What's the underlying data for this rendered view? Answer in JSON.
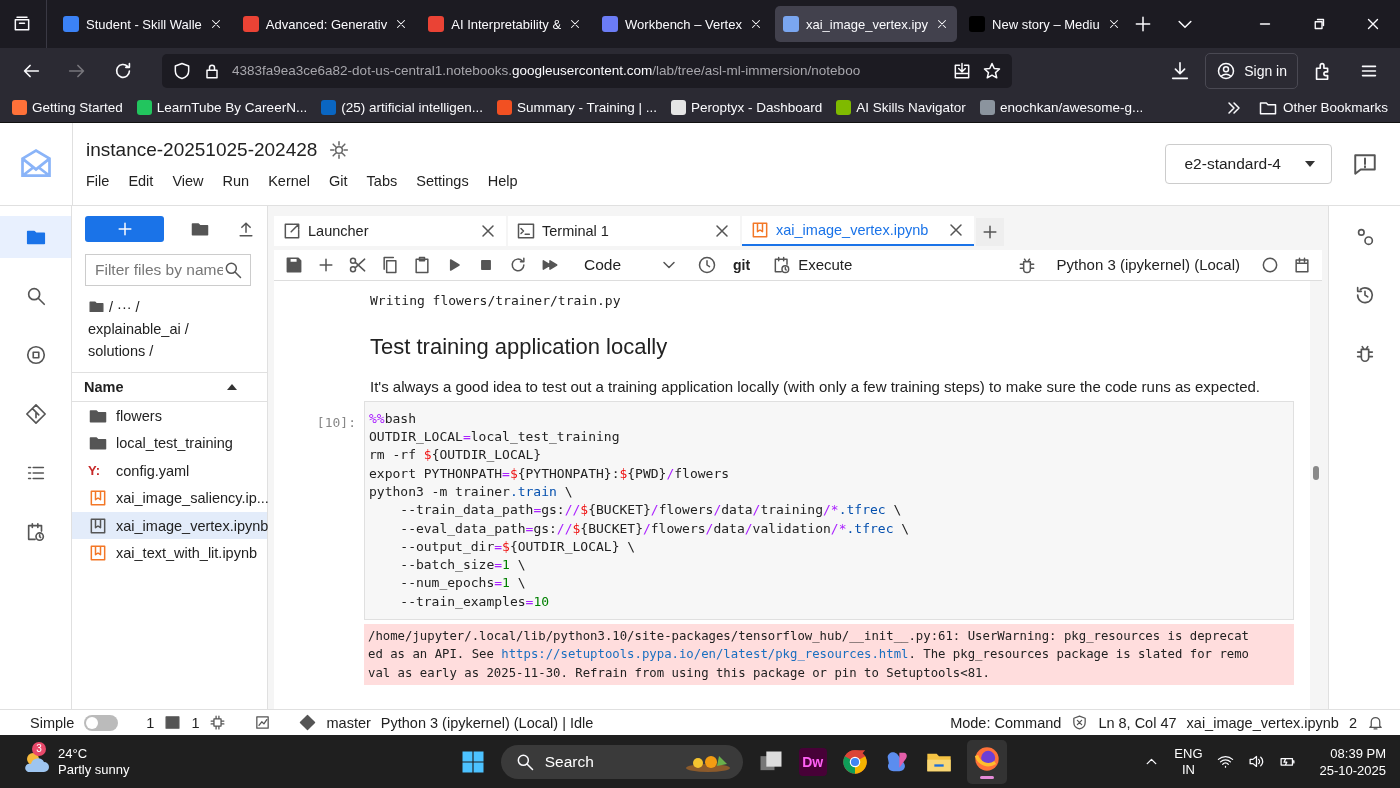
{
  "browser": {
    "tabs": [
      {
        "title": "Student - Skill Walle",
        "color": "#3b82f6",
        "selected": false
      },
      {
        "title": "Advanced: Generativ",
        "color": "#ea4335",
        "selected": false
      },
      {
        "title": "AI Interpretability &",
        "color": "#ea4335",
        "selected": false
      },
      {
        "title": "Workbench – Vertex",
        "color": "#6b7cf5",
        "selected": false
      },
      {
        "title": "xai_image_vertex.ipy",
        "color": "#7aa6f0",
        "selected": true
      },
      {
        "title": "New story – Mediu",
        "color": "#000000",
        "selected": false
      }
    ],
    "url": {
      "prefix": "4383fa9ea3ce6a82-dot-us-central1.notebooks.",
      "domain": "googleusercontent.com",
      "path": "/lab/tree/asl-ml-immersion/noteboo"
    },
    "sign_in": "Sign in",
    "bookmarks": [
      {
        "label": "Getting Started",
        "color": "#ff7139"
      },
      {
        "label": "LearnTube By CareerN...",
        "color": "#22c55e"
      },
      {
        "label": "(25) artificial intelligen...",
        "color": "#0a66c2"
      },
      {
        "label": "Summary - Training | ...",
        "color": "#f25022"
      },
      {
        "label": "Peroptyx - Dashboard",
        "color": "#e5e5e5"
      },
      {
        "label": "AI Skills Navigator",
        "color": "#7fba00"
      },
      {
        "label": "enochkan/awesome-g...",
        "color": "#8b949e"
      }
    ],
    "other_bookmarks": "Other Bookmarks"
  },
  "lab": {
    "title": "instance-20251025-202428",
    "menu": [
      "File",
      "Edit",
      "View",
      "Run",
      "Kernel",
      "Git",
      "Tabs",
      "Settings",
      "Help"
    ],
    "machine": "e2-standard-4",
    "activity_bar": [
      {
        "kind": "files",
        "selected": true
      },
      {
        "kind": "search",
        "selected": false
      },
      {
        "kind": "running",
        "selected": false
      },
      {
        "kind": "git",
        "selected": false
      },
      {
        "kind": "toc",
        "selected": false
      },
      {
        "kind": "schedule",
        "selected": false
      }
    ],
    "right_bar": [
      {
        "kind": "properties"
      },
      {
        "kind": "history"
      },
      {
        "kind": "debugger"
      }
    ]
  },
  "file_browser": {
    "filter_placeholder": "Filter files by name",
    "path": [
      "/ ··· /",
      "explainable_ai /",
      "solutions /"
    ],
    "column": "Name",
    "files": [
      {
        "name": "flowers",
        "kind": "folder",
        "selected": false
      },
      {
        "name": "local_test_training",
        "kind": "folder",
        "selected": false
      },
      {
        "name": "config.yaml",
        "kind": "yaml",
        "icon_text": "Y:",
        "selected": false
      },
      {
        "name": "xai_image_saliency.ip...",
        "kind": "notebook",
        "selected": false
      },
      {
        "name": "xai_image_vertex.ipynb",
        "kind": "notebook",
        "selected": true
      },
      {
        "name": "xai_text_with_lit.ipynb",
        "kind": "notebook",
        "selected": false
      }
    ]
  },
  "notebook": {
    "tabs": [
      {
        "label": "Launcher",
        "kind": "launcher",
        "selected": false
      },
      {
        "label": "Terminal 1",
        "kind": "terminal",
        "selected": false
      },
      {
        "label": "xai_image_vertex.ipynb",
        "kind": "notebook",
        "selected": true
      }
    ],
    "toolbar": {
      "cell_type": "Code",
      "git": "git",
      "execute": "Execute",
      "kernel": "Python 3 (ipykernel) (Local)"
    },
    "previous_output": "Writing flowers/trainer/train.py",
    "heading": "Test training application locally",
    "paragraph": "It's always a good idea to test out a training application locally (with only a few training steps) to make sure the code runs as expected.",
    "cell": {
      "prompt": "[10]:",
      "lines": [
        [
          {
            "text": "%%",
            "kind": "magic"
          },
          {
            "text": "bash",
            "kind": "plain"
          }
        ],
        [
          {
            "text": "OUTDIR_LOCAL",
            "kind": "plain"
          },
          {
            "text": "=",
            "kind": "op"
          },
          {
            "text": "local_test_training",
            "kind": "plain"
          }
        ],
        [
          {
            "text": "rm -rf ",
            "kind": "plain"
          },
          {
            "text": "$",
            "kind": "var"
          },
          {
            "text": "{OUTDIR_LOCAL}",
            "kind": "plain"
          }
        ],
        [
          {
            "text": "export PYTHONPATH",
            "kind": "plain"
          },
          {
            "text": "=",
            "kind": "op"
          },
          {
            "text": "$",
            "kind": "var"
          },
          {
            "text": "{PYTHONPATH}:",
            "kind": "plain"
          },
          {
            "text": "$",
            "kind": "var"
          },
          {
            "text": "{PWD}",
            "kind": "plain"
          },
          {
            "text": "/",
            "kind": "op"
          },
          {
            "text": "flowers",
            "kind": "plain"
          }
        ],
        [
          {
            "text": "python3 -m trainer",
            "kind": "plain"
          },
          {
            "text": ".train",
            "kind": "attr"
          },
          {
            "text": " \\",
            "kind": "plain"
          }
        ],
        [
          {
            "text": "    --train_data_path",
            "kind": "plain"
          },
          {
            "text": "=",
            "kind": "op"
          },
          {
            "text": "gs:",
            "kind": "plain"
          },
          {
            "text": "//",
            "kind": "op"
          },
          {
            "text": "$",
            "kind": "var"
          },
          {
            "text": "{BUCKET}",
            "kind": "plain"
          },
          {
            "text": "/",
            "kind": "op"
          },
          {
            "text": "flowers",
            "kind": "plain"
          },
          {
            "text": "/",
            "kind": "op"
          },
          {
            "text": "data",
            "kind": "plain"
          },
          {
            "text": "/",
            "kind": "op"
          },
          {
            "text": "training",
            "kind": "plain"
          },
          {
            "text": "/*",
            "kind": "op"
          },
          {
            "text": ".tfrec",
            "kind": "attr"
          },
          {
            "text": " \\",
            "kind": "plain"
          }
        ],
        [
          {
            "text": "    --eval_data_path",
            "kind": "plain"
          },
          {
            "text": "=",
            "kind": "op"
          },
          {
            "text": "gs:",
            "kind": "plain"
          },
          {
            "text": "//",
            "kind": "op"
          },
          {
            "text": "$",
            "kind": "var"
          },
          {
            "text": "{BUCKET}",
            "kind": "plain"
          },
          {
            "text": "/",
            "kind": "op"
          },
          {
            "text": "flowers",
            "kind": "plain"
          },
          {
            "text": "/",
            "kind": "op"
          },
          {
            "text": "data",
            "kind": "plain"
          },
          {
            "text": "/",
            "kind": "op"
          },
          {
            "text": "validation",
            "kind": "plain"
          },
          {
            "text": "/*",
            "kind": "op"
          },
          {
            "text": ".tfrec",
            "kind": "attr"
          },
          {
            "text": " \\",
            "kind": "plain"
          }
        ],
        [
          {
            "text": "    --output_dir",
            "kind": "plain"
          },
          {
            "text": "=",
            "kind": "op"
          },
          {
            "text": "$",
            "kind": "var"
          },
          {
            "text": "{OUTDIR_LOCAL} \\",
            "kind": "plain"
          }
        ],
        [
          {
            "text": "    --batch_size",
            "kind": "plain"
          },
          {
            "text": "=",
            "kind": "op"
          },
          {
            "text": "1",
            "kind": "num"
          },
          {
            "text": " \\",
            "kind": "plain"
          }
        ],
        [
          {
            "text": "    --num_epochs",
            "kind": "plain"
          },
          {
            "text": "=",
            "kind": "op"
          },
          {
            "text": "1",
            "kind": "num"
          },
          {
            "text": " \\",
            "kind": "plain"
          }
        ],
        [
          {
            "text": "    --train_examples",
            "kind": "plain"
          },
          {
            "text": "=",
            "kind": "op"
          },
          {
            "text": "10",
            "kind": "num"
          }
        ]
      ]
    },
    "warning": [
      [
        {
          "text": "/home/jupyter/.local/lib/python3.10/site-packages/tensorflow_hub/__init__.py:61: UserWarning: pkg_resources is deprecat",
          "kind": "plain"
        }
      ],
      [
        {
          "text": "ed as an API. See ",
          "kind": "plain"
        },
        {
          "text": "https://setuptools.pypa.io/en/latest/pkg_resources.html",
          "kind": "link"
        },
        {
          "text": ". The pkg_resources package is slated for remo",
          "kind": "plain"
        }
      ],
      [
        {
          "text": "val as early as 2025-11-30. Refrain from using this package or pin to Setuptools<81.",
          "kind": "plain"
        }
      ]
    ]
  },
  "status_bar": {
    "simple_label": "Simple",
    "simple_on": false,
    "terminals": "1",
    "kernels": "1",
    "branch": "master",
    "kernel_status": "Python 3 (ipykernel) (Local) | Idle",
    "mode": "Mode: Command",
    "position": "Ln 8, Col 47",
    "file": "xai_image_vertex.ipynb",
    "notifications": "2"
  },
  "taskbar": {
    "weather_badge": "3",
    "temperature": "24°C",
    "weather": "Partly sunny",
    "search": "Search",
    "app_label": "Dw",
    "language": "ENG",
    "region": "IN",
    "time": "08:39 PM",
    "date": "25-10-2025"
  }
}
